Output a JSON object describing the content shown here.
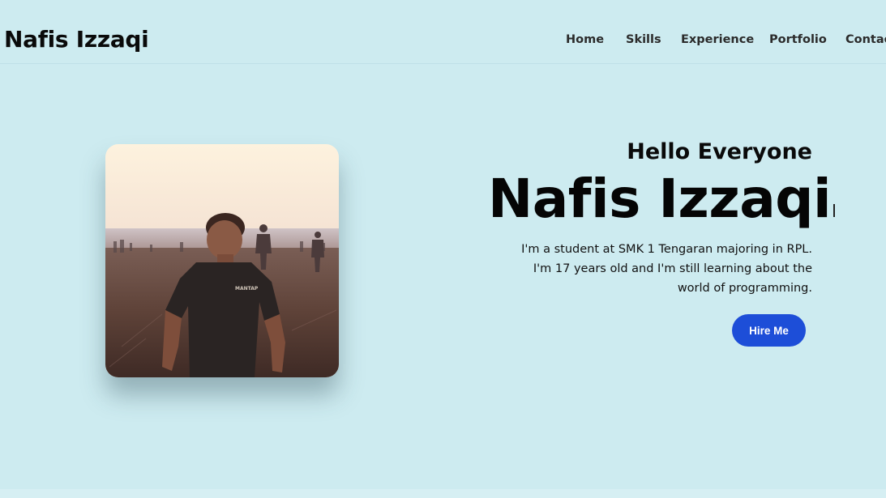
{
  "header": {
    "brand": "Nafis Izzaqi",
    "nav": [
      {
        "label": "Home"
      },
      {
        "label": "Skills"
      },
      {
        "label": "Experience"
      },
      {
        "label": "Portfolio"
      },
      {
        "label": "Contact"
      }
    ]
  },
  "hero": {
    "greeting": "Hello Everyone",
    "name": "Nafis Izzaqi",
    "bio": "I'm a student at SMK 1 Tengaran majoring in RPL. I'm 17 years old and I'm still learning about the world of programming.",
    "cta_label": "Hire Me",
    "photo_text": "MANTAP"
  },
  "colors": {
    "background": "#cdebf0",
    "accent": "#1d4ed8"
  }
}
